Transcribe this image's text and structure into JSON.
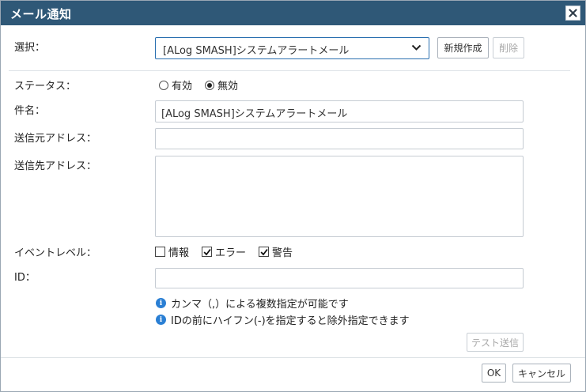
{
  "dialog": {
    "title": "メール通知",
    "close_label": "×"
  },
  "form": {
    "select_label": "選択：",
    "select_value": "[ALog SMASH]システムアラートメール",
    "new_button": "新規作成",
    "delete_button": "削除",
    "status_label": "ステータス：",
    "status_options": [
      "有効",
      "無効"
    ],
    "status_selected": "無効",
    "subject_label": "件名：",
    "subject_value": "[ALog SMASH]システムアラートメール",
    "from_label": "送信元アドレス：",
    "from_value": "",
    "to_label": "送信先アドレス：",
    "to_value": "",
    "event_label": "イベントレベル：",
    "event_levels": [
      {
        "label": "情報",
        "checked": false
      },
      {
        "label": "エラー",
        "checked": true
      },
      {
        "label": "警告",
        "checked": true
      }
    ],
    "id_label": "ID：",
    "id_value": "",
    "info_notes": [
      "カンマ（,）による複数指定が可能です",
      "IDの前にハイフン(-)を指定すると除外指定できます"
    ],
    "test_send_button": "テスト送信"
  },
  "footer": {
    "ok_button": "OK",
    "cancel_button": "キャンセル"
  },
  "colors": {
    "titlebar": "#2f5877",
    "focus_border": "#2a6fb0",
    "info_icon": "#2a7fd4"
  }
}
